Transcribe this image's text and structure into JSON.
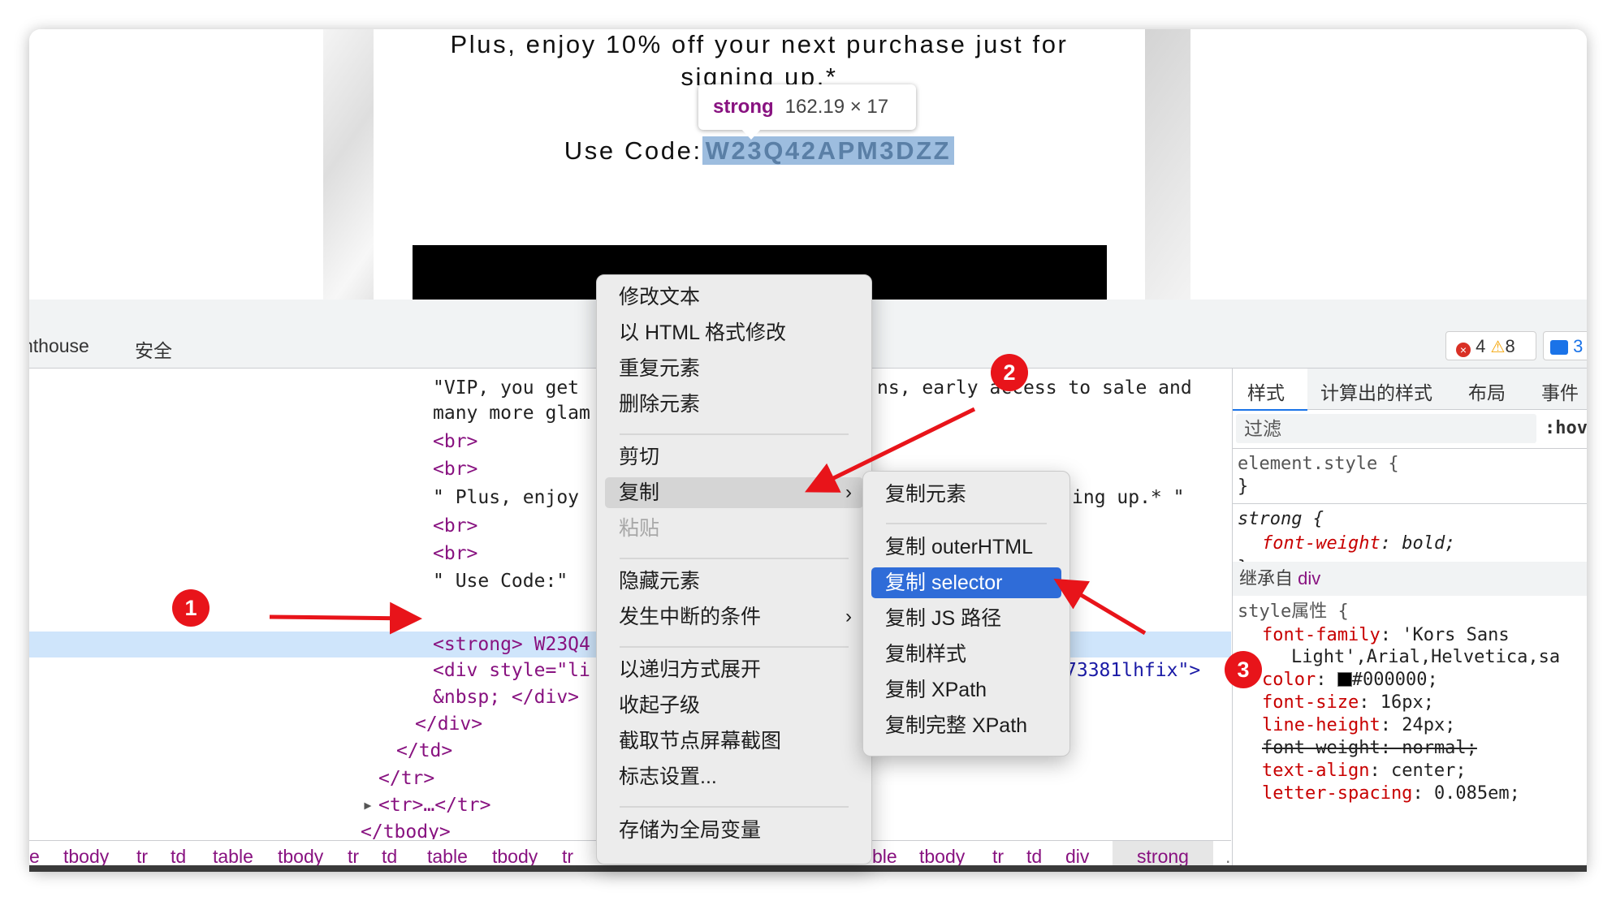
{
  "page": {
    "promo_line1": "Plus, enjoy 10% off your next purchase just for",
    "promo_line2": "signing up.*",
    "code_label": "Use Code:",
    "code_value": "W23Q42APM3DZZ"
  },
  "tooltip": {
    "tag": "strong",
    "size": "162.19 × 17"
  },
  "devtools": {
    "tabs": [
      "hthouse",
      "安全"
    ],
    "error_count": "4",
    "warning_count": "8",
    "issues_count": "3",
    "tree": {
      "lines": [
        "\"VIP, you get",
        "many more glam",
        "<br>",
        "<br>",
        "\" Plus, enjoy",
        "<br>",
        "<br>",
        "\" Use Code:\"",
        "<strong> W23Q4",
        "<div style=\"li",
        "&nbsp; </div>",
        "</div>",
        "</td>",
        "</tr>",
        "<tr>…</tr>",
        "</tbody>"
      ],
      "right_fragments": {
        "vip_tail": "ns, early access to sale and",
        "plus_tail": "ing up.* \"",
        "div_tail": "73381lhfix\">"
      }
    },
    "breadcrumbs": [
      "e",
      "tbody",
      "tr",
      "td",
      "table",
      "tbody",
      "tr",
      "td",
      "table",
      "tbody",
      "tr",
      "ble",
      "tbody",
      "tr",
      "td",
      "div",
      "strong"
    ],
    "breadcrumb_more": "…",
    "styles": {
      "tabs": [
        "样式",
        "计算出的样式",
        "布局",
        "事件"
      ],
      "filter_placeholder": "过滤",
      "hov_label": ":hov",
      "element_style_selector": "element.style {",
      "close_brace": "}",
      "strong_selector": "strong {",
      "strong_prop": "font-weight",
      "strong_val": "bold;",
      "inherited_label": "继承自",
      "inherited_tag": "div",
      "style_attr_label": "style属性 {",
      "props": [
        {
          "name": "font-family",
          "value": "'Kors Sans"
        },
        {
          "name": "",
          "value": "Light',Arial,Helvetica,sa"
        },
        {
          "name": "color",
          "value": "#000000;"
        },
        {
          "name": "font-size",
          "value": "16px;"
        },
        {
          "name": "line-height",
          "value": "24px;"
        },
        {
          "name": "font-weight",
          "value": "normal;"
        },
        {
          "name": "text-align",
          "value": "center;"
        },
        {
          "name": "letter-spacing",
          "value": "0.085em;"
        }
      ]
    }
  },
  "context_menu": {
    "items": [
      "修改文本",
      "以 HTML 格式修改",
      "重复元素",
      "删除元素",
      "剪切",
      "复制",
      "粘贴",
      "隐藏元素",
      "发生中断的条件",
      "以递归方式展开",
      "收起子级",
      "截取节点屏幕截图",
      "标志设置...",
      "存储为全局变量"
    ]
  },
  "copy_submenu": {
    "items": [
      "复制元素",
      "复制 outerHTML",
      "复制 selector",
      "复制 JS 路径",
      "复制样式",
      "复制 XPath",
      "复制完整 XPath"
    ]
  },
  "annotations": {
    "badges": [
      "1",
      "2",
      "3"
    ]
  },
  "colors": {
    "accent": "#2f6cd8",
    "annotation_red": "#e8141a",
    "tag": "#881280",
    "selection_row": "#cfe5fb"
  }
}
